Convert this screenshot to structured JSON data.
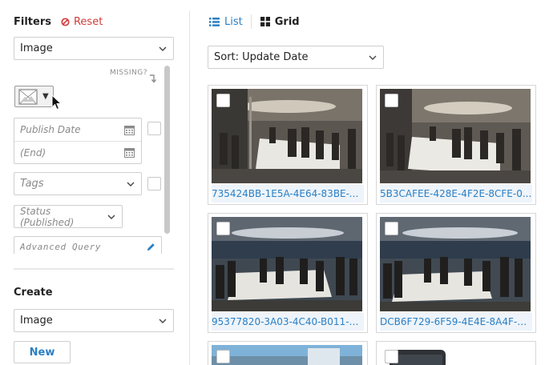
{
  "filters": {
    "title": "Filters",
    "reset_label": "Reset",
    "type_select": "Image",
    "missing_label": "MISSING?",
    "publish_date_placeholder": "Publish Date",
    "end_date_placeholder": "(End)",
    "tags_placeholder": "Tags",
    "status_placeholder": "Status (Published)",
    "advanced_query_placeholder": "Advanced Query"
  },
  "create": {
    "title": "Create",
    "type_select": "Image",
    "new_label": "New"
  },
  "view": {
    "list_label": "List",
    "grid_label": "Grid",
    "selected": "grid"
  },
  "sort": {
    "label": "Sort: Update Date"
  },
  "results": [
    {
      "caption": "735424BB-1E5A-4E64-83BE-B..."
    },
    {
      "caption": "5B3CAFEE-428E-4F2E-8CFE-0..."
    },
    {
      "caption": "95377820-3A03-4C40-B011-4..."
    },
    {
      "caption": "DCB6F729-6F59-4E4E-8A4F-7..."
    },
    {
      "caption": ""
    },
    {
      "caption": ""
    }
  ],
  "colors": {
    "accent": "#2a7fc4",
    "reset": "#d23b3b"
  }
}
